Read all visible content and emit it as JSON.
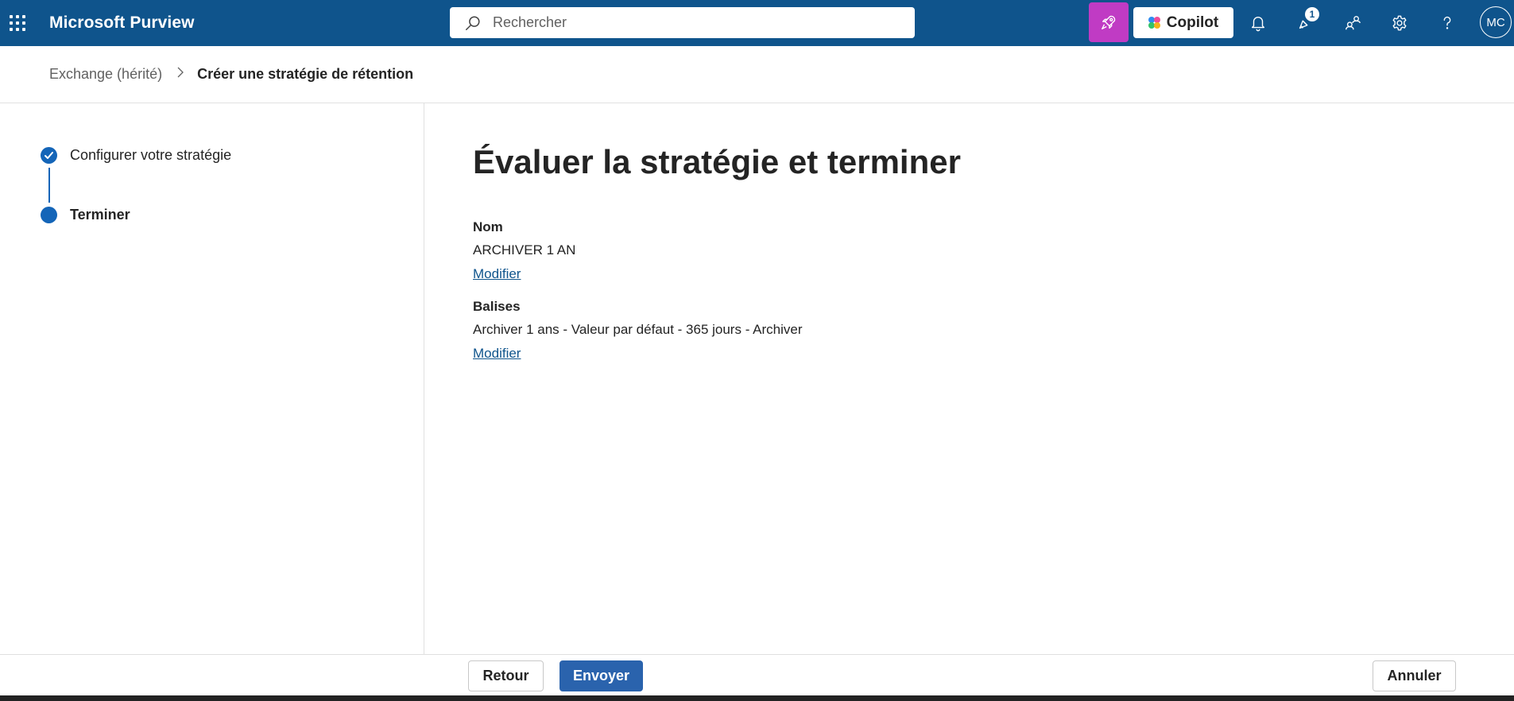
{
  "topbar": {
    "app_title": "Microsoft Purview",
    "search_placeholder": "Rechercher",
    "copilot_label": "Copilot",
    "notification_count": "1",
    "avatar_initials": "MC"
  },
  "breadcrumb": {
    "parent": "Exchange (hérité)",
    "current": "Créer une stratégie de rétention"
  },
  "steps": [
    {
      "label": "Configurer votre stratégie",
      "state": "completed"
    },
    {
      "label": "Terminer",
      "state": "current"
    }
  ],
  "main": {
    "title": "Évaluer la stratégie et terminer",
    "fields": [
      {
        "label": "Nom",
        "value": "ARCHIVER 1 AN",
        "edit_label": "Modifier"
      },
      {
        "label": "Balises",
        "value": "Archiver 1 ans - Valeur par défaut - 365 jours - Archiver",
        "edit_label": "Modifier"
      }
    ]
  },
  "footer": {
    "back_label": "Retour",
    "submit_label": "Envoyer",
    "cancel_label": "Annuler"
  },
  "colors": {
    "topbar": "#0f548c",
    "accent": "#1465b8",
    "primary_button": "#2a63ad",
    "magic_button": "#c03bc4"
  }
}
